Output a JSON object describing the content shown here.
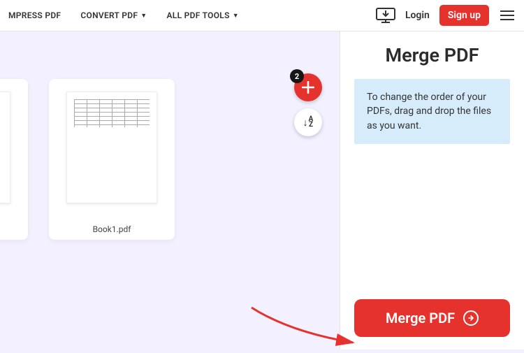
{
  "nav": {
    "compress": "MPRESS PDF",
    "convert": "CONVERT PDF",
    "all_tools": "ALL PDF TOOLS",
    "login": "Login",
    "signup": "Sign up"
  },
  "files": {
    "count_badge": "2",
    "items": [
      {
        "name": ""
      },
      {
        "name": "Book1.pdf"
      }
    ]
  },
  "sort_icon": {
    "arrow": "↓",
    "a": "A",
    "z": "Z"
  },
  "side": {
    "title": "Merge PDF",
    "info": "To change the order of your PDFs, drag and drop the files as you want.",
    "button": "Merge PDF"
  }
}
